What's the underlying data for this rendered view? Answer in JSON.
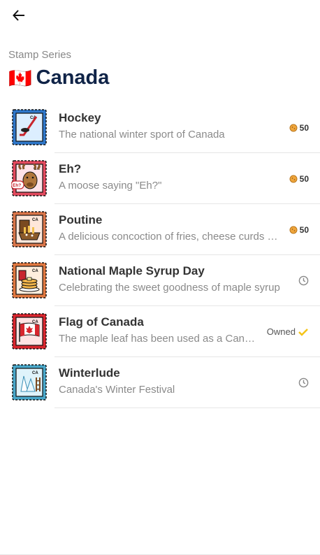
{
  "header": {
    "back_icon": "arrow-left-icon",
    "subtitle": "Stamp Series",
    "flag_glyph": "🇨🇦",
    "title": "Canada"
  },
  "stamps": [
    {
      "title": "Hockey",
      "subtitle": "The national winter sport of Canada",
      "status": "coins",
      "value": "50",
      "stamp_label": "CA",
      "icon": "hockey-stick-icon",
      "colors": {
        "border": "#2f77c9",
        "bg": "#dceeff"
      }
    },
    {
      "title": "Eh?",
      "subtitle": "A moose saying \"Eh?\"",
      "status": "coins",
      "value": "50",
      "stamp_label": "CA",
      "icon": "moose-icon",
      "badge": "Eh?",
      "colors": {
        "border": "#e24a5e",
        "bg": "#ffe3e8"
      }
    },
    {
      "title": "Poutine",
      "subtitle": "A delicious concoction of fries, cheese curds and gravy",
      "status": "coins",
      "value": "50",
      "stamp_label": "CA",
      "icon": "poutine-icon",
      "colors": {
        "border": "#d9764a",
        "bg": "#ffe7da"
      }
    },
    {
      "title": "National Maple Syrup Day",
      "subtitle": "Celebrating the sweet goodness of maple syrup",
      "status": "clock",
      "stamp_label": "CA",
      "icon": "pancakes-icon",
      "colors": {
        "border": "#e07840",
        "bg": "#ffeedd"
      }
    },
    {
      "title": "Flag of Canada",
      "subtitle": "The maple leaf has been used as a Canadian symbol",
      "status": "owned",
      "owned_label": "Owned",
      "stamp_label": "CA",
      "icon": "canada-flag-icon",
      "colors": {
        "border": "#d8262e",
        "bg": "#ffe3e3"
      }
    },
    {
      "title": "Winterlude",
      "subtitle": "Canada's Winter Festival",
      "status": "clock",
      "stamp_label": "CA",
      "icon": "winter-festival-icon",
      "colors": {
        "border": "#49a7c9",
        "bg": "#dff3fb"
      }
    }
  ],
  "colors": {
    "title": "#0f2347",
    "coin": "#f0a63b",
    "check": "#f5c518",
    "clock": "#888888"
  }
}
